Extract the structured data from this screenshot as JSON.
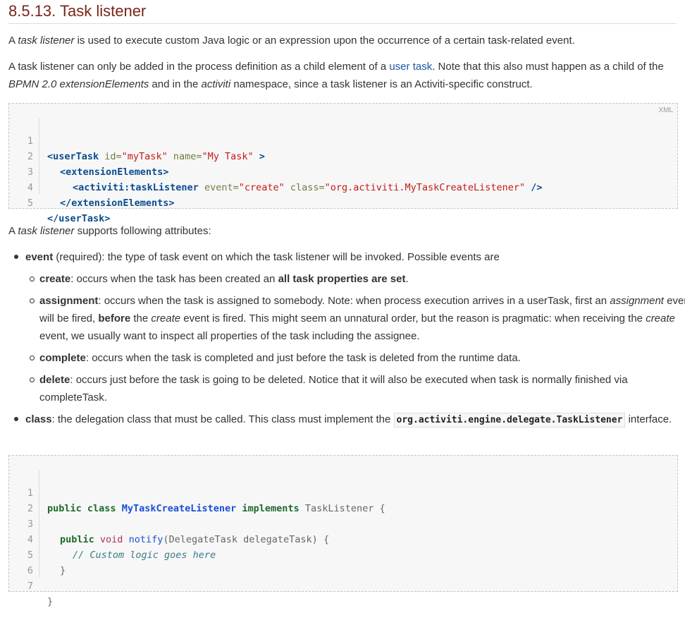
{
  "section": {
    "title": "8.5.13. Task listener"
  },
  "intro1": {
    "prefix": "A ",
    "em": "task listener",
    "suffix": " is used to execute custom Java logic or an expression upon the occurrence of a certain task-related event."
  },
  "intro2": {
    "part1": "A task listener can only be added in the process definition as a child element of a ",
    "link": "user task",
    "part2": ". Note that this also must happen as a child of the ",
    "em1": "BPMN 2.0 extensionElements",
    "part3": " and in the ",
    "em2": "activiti",
    "part4": " namespace, since a task listener is an Activiti-specific construct."
  },
  "xml_block": {
    "lang": "XML",
    "line_numbers": [
      "1",
      "2",
      "3",
      "4",
      "5"
    ],
    "l1": {
      "open": "<userTask",
      "a1": " id=",
      "v1": "\"myTask\"",
      "a2": " name=",
      "v2": "\"My Task\"",
      "close": " >"
    },
    "l2": {
      "text": "<extensionElements>"
    },
    "l3": {
      "open": "<activiti:taskListener",
      "a1": " event=",
      "v1": "\"create\"",
      "a2": " class=",
      "v2": "\"org.activiti.MyTaskCreateListener\"",
      "close": " />"
    },
    "l4": {
      "text": "</extensionElements>"
    },
    "l5": {
      "text": "</userTask>"
    }
  },
  "attrs_intro": {
    "prefix": "A ",
    "em": "task listener",
    "suffix": " supports following attributes:"
  },
  "event_item": {
    "label": "event",
    "text": " (required): the type of task event on which the task listener will be invoked. Possible events are",
    "create": {
      "label": "create",
      "text1": ": occurs when the task has been created an ",
      "bold": "all task properties are set",
      "text2": "."
    },
    "assignment": {
      "label": "assignment",
      "text1": ": occurs when the task is assigned to somebody. Note: when process execution arrives in a userTask, first an ",
      "em1": "assignment",
      "text2": " event will be fired, ",
      "bold": "before",
      "text3": " the ",
      "em2": "create",
      "text4": " event is fired. This might seem an unnatural order, but the reason is pragmatic: when receiving the ",
      "em3": "create",
      "text5": " event, we usually want to inspect all properties of the task including the assignee."
    },
    "complete": {
      "label": "complete",
      "text": ": occurs when the task is completed and just before the task is deleted from the runtime data."
    },
    "delete": {
      "label": "delete",
      "text": ": occurs just before the task is going to be deleted. Notice that it will also be executed when task is normally finished via completeTask."
    }
  },
  "class_item": {
    "label": "class",
    "text1": ": the delegation class that must be called. This class must implement the ",
    "code": "org.activiti.engine.delegate.TaskListener",
    "text2": " interface."
  },
  "java_block": {
    "line_numbers": [
      "1",
      "2",
      "3",
      "4",
      "5",
      "6",
      "7"
    ],
    "l1": {
      "kw1": "public",
      "kw2": "class",
      "cls": "MyTaskCreateListener",
      "kw3": "implements",
      "iface": "TaskListener",
      "brace": "{"
    },
    "l3": {
      "kw1": "public",
      "kw2": "void",
      "fn": "notify",
      "params": "(DelegateTask delegateTask)",
      "brace": "{"
    },
    "l4": {
      "comment": "// Custom logic goes here"
    },
    "l5": {
      "brace": "}"
    },
    "l7": {
      "brace": "}"
    }
  }
}
